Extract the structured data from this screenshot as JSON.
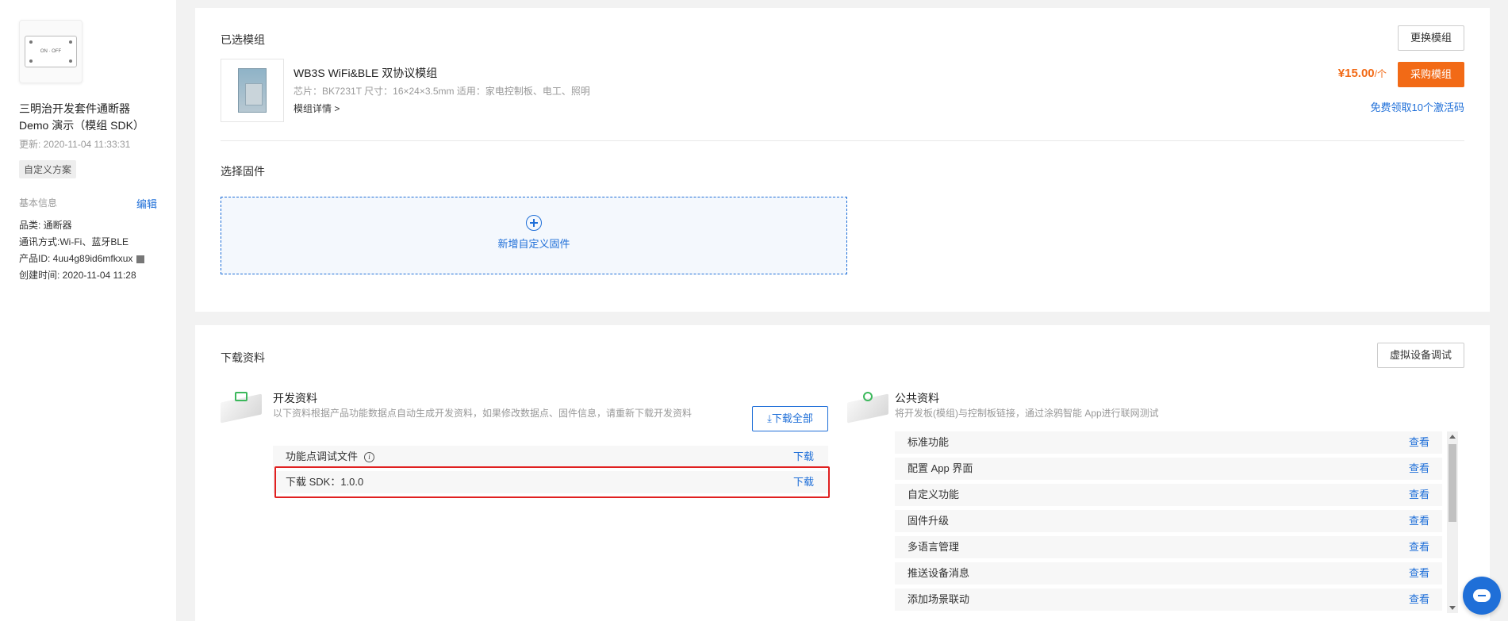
{
  "sidebar": {
    "switch_label": "ON · OFF",
    "product_name": "三明治开发套件通断器 Demo 演示（模组 SDK）",
    "updated": "更新: 2020-11-04 11:33:31",
    "tag": "自定义方案",
    "info_title": "基本信息",
    "edit_label": "编辑",
    "category": "品类: 通断器",
    "comm": "通讯方式:Wi-Fi、蓝牙BLE",
    "product_id": "产品ID: 4uu4g89id6mfkxux",
    "created": "创建时间: 2020-11-04 11:28"
  },
  "module": {
    "section_title": "已选模组",
    "change_btn": "更换模组",
    "name": "WB3S WiFi&BLE 双协议模组",
    "spec": "芯片：BK7231T   尺寸：16×24×3.5mm   适用：家电控制板、电工、照明",
    "detail_link": "模组详情 >",
    "price": "¥15.00",
    "price_unit": "/个",
    "buy_btn": "采购模组",
    "free_link": "免费领取10个激活码"
  },
  "firmware": {
    "section_title": "选择固件",
    "add_label": "新增自定义固件"
  },
  "downloads": {
    "section_title": "下载资料",
    "virtual_btn": "虚拟设备调试",
    "dev_title": "开发资料",
    "dev_desc": "以下资料根据产品功能数据点自动生成开发资料，如果修改数据点、固件信息，请重新下载开发资料",
    "download_all": "下载全部",
    "rows": [
      {
        "label": "功能点调试文件",
        "link": "下载"
      },
      {
        "label": "下载 SDK：1.0.0",
        "link": "下载"
      }
    ],
    "pub_title": "公共资料",
    "pub_desc": "将开发板(模组)与控制板链接，通过涂鸦智能 App进行联网测试",
    "pub_rows": [
      {
        "label": "标准功能",
        "link": "查看"
      },
      {
        "label": "配置 App 界面",
        "link": "查看"
      },
      {
        "label": "自定义功能",
        "link": "查看"
      },
      {
        "label": "固件升级",
        "link": "查看"
      },
      {
        "label": "多语言管理",
        "link": "查看"
      },
      {
        "label": "推送设备消息",
        "link": "查看"
      },
      {
        "label": "添加场景联动",
        "link": "查看"
      }
    ]
  },
  "colors": {
    "accent": "#1f6fd8",
    "orange": "#f26a16",
    "highlight": "#e02020"
  }
}
